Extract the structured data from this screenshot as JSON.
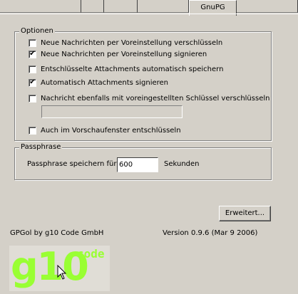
{
  "tabs": [
    {
      "label": ""
    },
    {
      "label": ""
    },
    {
      "label": ""
    },
    {
      "label": ""
    },
    {
      "label": "GnuPG",
      "active": true
    },
    {
      "label": ""
    }
  ],
  "optionen": {
    "title": "Optionen",
    "items": [
      {
        "label": "Neue Nachrichten per Voreinstellung verschlüsseln",
        "checked": false
      },
      {
        "label": "Neue Nachrichten per Voreinstellung signieren",
        "checked": true
      },
      {
        "label": "Entschlüsselte Attachments automatisch speichern",
        "checked": false
      },
      {
        "label": "Automatisch Attachments signieren",
        "checked": true
      },
      {
        "label": "Nachricht ebenfalls mit voreingestellten Schlüssel verschlüsseln",
        "checked": false
      },
      {
        "label": "Auch im Vorschaufenster entschlüsseln",
        "checked": false
      }
    ],
    "key_field_value": ""
  },
  "passphrase": {
    "title": "Passphrase",
    "label": "Passphrase speichern für",
    "value": "600",
    "unit": "Sekunden"
  },
  "advanced_button": "Erweitert...",
  "footer": {
    "product": "GPGol by g10 Code GmbH",
    "version": "Version 0.9.6 (Mar  9 2006)"
  },
  "logo": {
    "main": "g10",
    "sup": "code"
  },
  "colors": {
    "logo_green": "#99ff33",
    "dialog_bg": "#d4d0c8"
  }
}
